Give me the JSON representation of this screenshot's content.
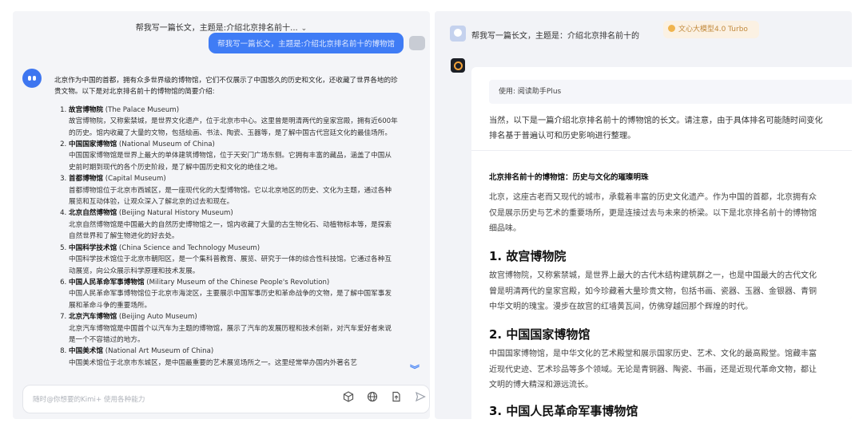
{
  "left": {
    "conversation_title": "帮我写一篇长文，主题是:介绍北京排名前十...",
    "user_message": "帮我写一篇长文，主题是:介绍北京排名前十的博物馆",
    "answer_intro": "北京作为中国的首都，拥有众多世界级的博物馆，它们不仅展示了中国悠久的历史和文化，还收藏了世界各地的珍贵文物。以下是对北京排名前十的博物馆的简要介绍:",
    "museums": [
      {
        "name": "故宫博物院",
        "en": "(The Palace Museum)",
        "desc": "故宫博物院，又称紫禁城，是世界文化遗产，位于北京市中心。这里曾是明清两代的皇家宫殿，拥有近600年的历史。馆内收藏了大量的文物，包括绘画、书法、陶瓷、玉器等，是了解中国古代宫廷文化的最佳场所。"
      },
      {
        "name": "中国国家博物馆",
        "en": "(National Museum of China)",
        "desc": "中国国家博物馆是世界上最大的单体建筑博物馆，位于天安门广场东侧。它拥有丰富的藏品，涵盖了中国从史前时期到现代的各个历史阶段，是了解中国历史和文化的绝佳之地。"
      },
      {
        "name": "首都博物馆",
        "en": "(Capital Museum)",
        "desc": "首都博物馆位于北京市西城区，是一座现代化的大型博物馆。它以北京地区的历史、文化为主题，通过各种展览和互动体验，让观众深入了解北京的过去和现在。"
      },
      {
        "name": "北京自然博物馆",
        "en": "(Beijing Natural History Museum)",
        "desc": "北京自然博物馆是中国最大的自然历史博物馆之一，馆内收藏了大量的古生物化石、动植物标本等，是探索自然世界和了解生物进化的好去处。"
      },
      {
        "name": "中国科学技术馆",
        "en": "(China Science and Technology Museum)",
        "desc": "中国科学技术馆位于北京市朝阳区，是一个集科普教育、展览、研究于一体的综合性科技馆。它通过各种互动展览，向公众展示科学原理和技术发展。"
      },
      {
        "name": "中国人民革命军事博物馆",
        "en": "(Military Museum of the Chinese People's Revolution)",
        "desc": "中国人民革命军事博物馆位于北京市海淀区，主要展示中国军事历史和革命战争的文物，是了解中国军事发展和革命斗争的重要场所。"
      },
      {
        "name": "北京汽车博物馆",
        "en": "(Beijing Auto Museum)",
        "desc": "北京汽车博物馆是中国首个以汽车为主题的博物馆，展示了汽车的发展历程和技术创新，对汽车爱好者来说是一个不容错过的地方。"
      },
      {
        "name": "中国美术馆",
        "en": "(National Art Museum of China)",
        "desc": "中国美术馆位于北京市东城区，是中国最重要的艺术展览场所之一。这里经常举办国内外著名艺"
      }
    ],
    "input_placeholder": "随时@你想要的Kimi+ 使用各种能力",
    "icons": [
      "cube-icon",
      "globe-icon",
      "file-upload-icon",
      "send-icon"
    ]
  },
  "right": {
    "conversation_title": "帮我写一篇长文，主题是：介绍北京排名前十的",
    "model_badge": "文心大模型4.0 Turbo",
    "plugin_label": "使用: 阅读助手Plus",
    "intro_lines": [
      "当然，以下是一篇介绍北京排名前十的博物馆的长文。请注意，由于具体排名可能随时间变化",
      "排名基于普遍认可和历史影响进行整理。"
    ],
    "subtitle": "北京排名前十的博物馆：历史与文化的璀璨明珠",
    "para1_lines": [
      "北京，这座古老而又现代的城市，承载着丰富的历史文化遗产。作为中国的首都，北京拥有众",
      "仅是展示历史与艺术的重要场所，更是连接过去与未来的桥梁。以下是北京排名前十的博物馆",
      "细品味。"
    ],
    "h1": "1. 故宫博物院",
    "para2_lines": [
      "故宫博物院，又称紫禁城，是世界上最大的古代木结构建筑群之一，也是中国最大的古代文化",
      "曾是明清两代的皇家宫殿，如今珍藏着大量珍贵文物，包括书画、瓷器、玉器、金银器、青铜",
      "中华文明的瑰宝。漫步在故宫的红墙黄瓦间，仿佛穿越回那个辉煌的时代。"
    ],
    "h2": "2. 中国国家博物馆",
    "para3_lines": [
      "中国国家博物馆，是中华文化的艺术殿堂和展示国家历史、艺术、文化的最高殿堂。馆藏丰富",
      "近现代史迹、艺术珍品等多个领域。无论是青铜器、陶瓷、书画，还是近现代革命文物，都让",
      "文明的博大精深和源远流长。"
    ],
    "h3": "3. 中国人民革命军事博物馆"
  }
}
